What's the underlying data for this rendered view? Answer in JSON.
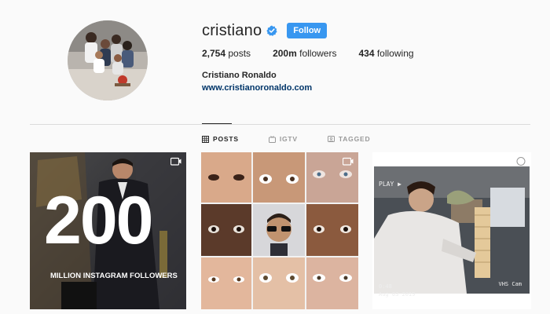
{
  "profile": {
    "username": "cristiano",
    "verified": true,
    "follow_label": "Follow",
    "full_name": "Cristiano Ronaldo",
    "website": "www.cristianoronaldo.com"
  },
  "stats": {
    "posts_count": "2,754",
    "posts_label": "posts",
    "followers_count": "200m",
    "followers_label": "followers",
    "following_count": "434",
    "following_label": "following"
  },
  "tabs": [
    {
      "label": "POSTS",
      "icon": "grid-icon",
      "active": true
    },
    {
      "label": "IGTV",
      "icon": "igtv-icon",
      "active": false
    },
    {
      "label": "TAGGED",
      "icon": "tagged-icon",
      "active": false
    }
  ],
  "posts": [
    {
      "big_text": "200",
      "caption": "MILLION INSTAGRAM FOLLOWERS",
      "badge": "igtv-icon"
    },
    {
      "badge": "igtv-icon"
    },
    {
      "vhs_play": "PLAY ▶",
      "vhs_time": "0:48",
      "vhs_date": "Aug 03 2019",
      "vhs_cam": "VHS Cam"
    }
  ],
  "colors": {
    "follow_button": "#3897f0",
    "link": "#003569",
    "verified": "#3897f0",
    "divider": "#dbdbdb"
  }
}
